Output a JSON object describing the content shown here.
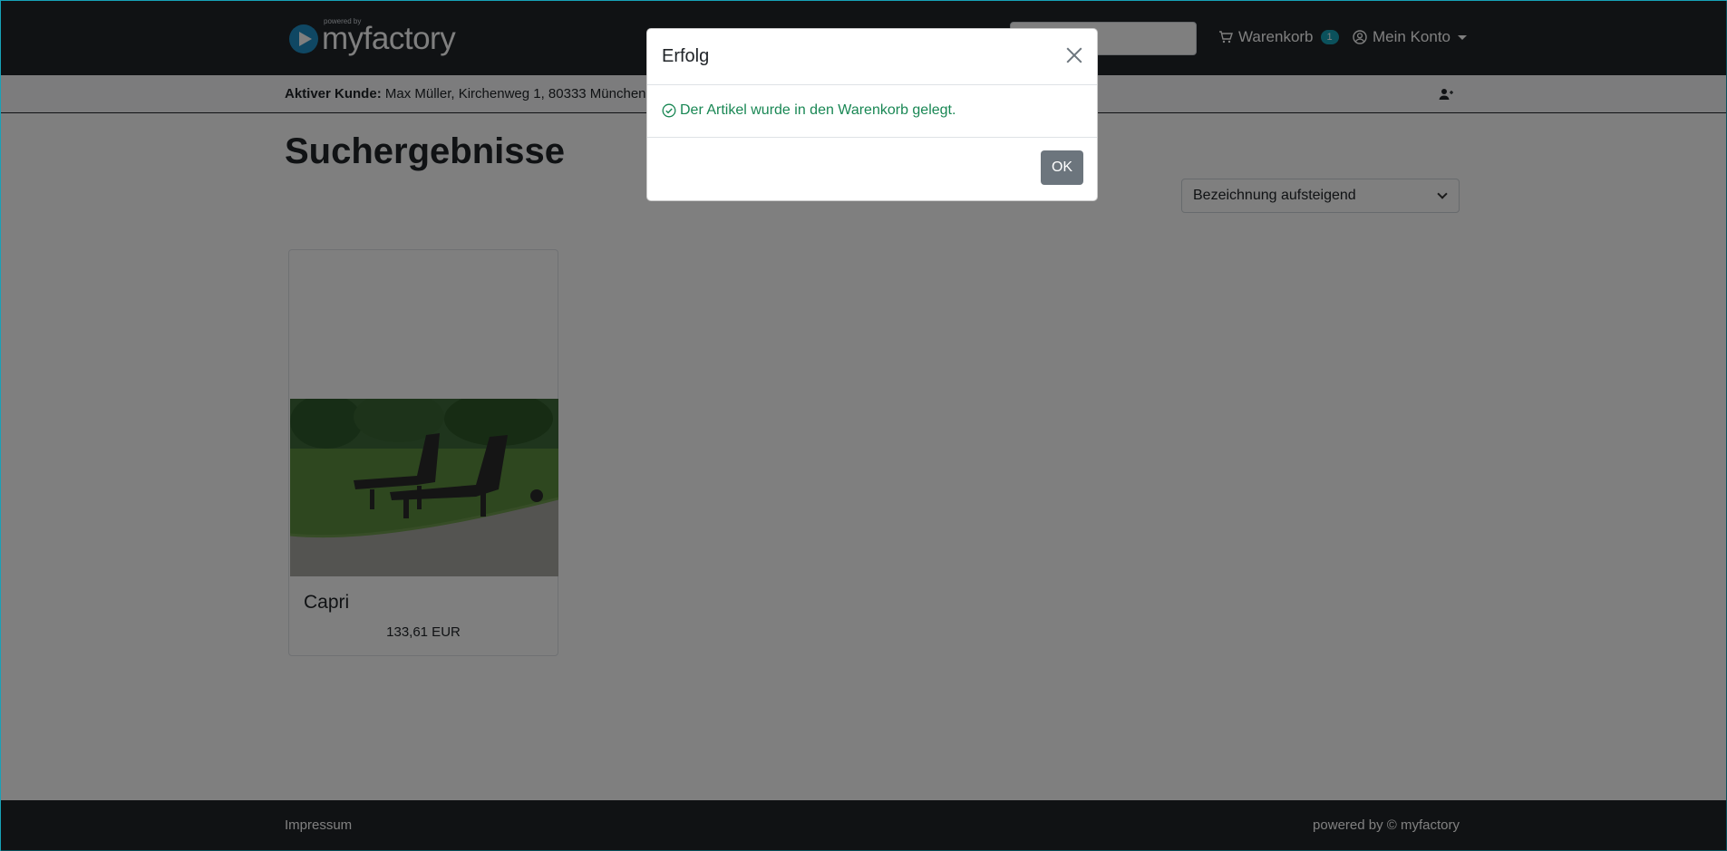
{
  "navbar": {
    "brand_powered": "powered by",
    "brand_name": "myfactory",
    "search_placeholder": "",
    "cart_label": "Warenkorb",
    "cart_count": "1",
    "account_label": "Mein Konto"
  },
  "customer_bar": {
    "label": "Aktiver Kunde:",
    "value": "Max Müller, Kirchenweg 1, 80333 München"
  },
  "main": {
    "title": "Suchergebnisse",
    "sort_selected": "Bezeichnung aufsteigend",
    "products": [
      {
        "name": "Capri",
        "price": "133,61 EUR"
      }
    ]
  },
  "footer": {
    "left_link": "Impressum",
    "right_text": "powered by © myfactory"
  },
  "modal": {
    "title": "Erfolg",
    "message": "Der Artikel wurde in den Warenkorb gelegt.",
    "ok_label": "OK"
  },
  "colors": {
    "navbar_bg": "#212529",
    "badge": "#17a2b8",
    "success_text": "#198754",
    "ok_button": "#6c757d"
  },
  "icons": [
    "play-logo-icon",
    "cart-icon",
    "user-circle-icon",
    "caret-down-icon",
    "user-plus-icon",
    "chevron-down-icon",
    "close-icon",
    "check-circle-icon"
  ]
}
